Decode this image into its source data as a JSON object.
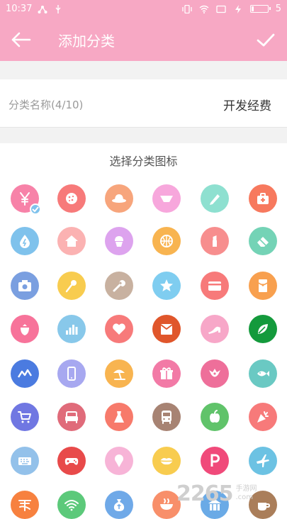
{
  "status_bar": {
    "time": "10:37",
    "battery": "5"
  },
  "toolbar": {
    "title": "添加分类"
  },
  "category_name": {
    "label": "分类名称(4/10)",
    "value": "开发经费"
  },
  "icon_section": {
    "title": "选择分类图标"
  },
  "icons": [
    {
      "name": "yen-icon",
      "color": "#f782a8",
      "selected": true
    },
    {
      "name": "cookie-icon",
      "color": "#f77a7a"
    },
    {
      "name": "hat-icon",
      "color": "#f7a57c"
    },
    {
      "name": "underwear-icon",
      "color": "#f7a7dc"
    },
    {
      "name": "pen-icon",
      "color": "#8ee0d0"
    },
    {
      "name": "first-aid-icon",
      "color": "#f7795e"
    },
    {
      "name": "water-drop-icon",
      "color": "#7fc2ec"
    },
    {
      "name": "house-icon",
      "color": "#fbb2b2"
    },
    {
      "name": "cupcake-icon",
      "color": "#dda3ee"
    },
    {
      "name": "basketball-icon",
      "color": "#f8b450"
    },
    {
      "name": "lipstick-icon",
      "color": "#f78e8e"
    },
    {
      "name": "eraser-icon",
      "color": "#74d3b6"
    },
    {
      "name": "camera-icon",
      "color": "#7a9fe0"
    },
    {
      "name": "microphone-icon",
      "color": "#f8cc4f"
    },
    {
      "name": "wrench-icon",
      "color": "#c8b1a0"
    },
    {
      "name": "star-icon",
      "color": "#7fcdf0"
    },
    {
      "name": "credit-card-icon",
      "color": "#f77a7a"
    },
    {
      "name": "red-envelope-icon",
      "color": "#f8a04f"
    },
    {
      "name": "strawberry-icon",
      "color": "#f7739a"
    },
    {
      "name": "bar-chart-icon",
      "color": "#88c8ea"
    },
    {
      "name": "heart-icon",
      "color": "#f77a7a"
    },
    {
      "name": "envelope-icon",
      "color": "#e0562b"
    },
    {
      "name": "high-heel-icon",
      "color": "#f7a7c8"
    },
    {
      "name": "leaf-icon",
      "color": "#149a3c"
    },
    {
      "name": "mountain-chart-icon",
      "color": "#4b7be0"
    },
    {
      "name": "phone-icon",
      "color": "#a7a8f0"
    },
    {
      "name": "beach-umbrella-icon",
      "color": "#f8b450"
    },
    {
      "name": "gift-icon",
      "color": "#f27aa6"
    },
    {
      "name": "bird-icon",
      "color": "#ee6f9a"
    },
    {
      "name": "fish-icon",
      "color": "#6ac9c3"
    },
    {
      "name": "shopping-cart-icon",
      "color": "#7077e2"
    },
    {
      "name": "sofa-icon",
      "color": "#e06b7a"
    },
    {
      "name": "dress-icon",
      "color": "#f77a6b"
    },
    {
      "name": "bus-icon",
      "color": "#a78373"
    },
    {
      "name": "apple-icon",
      "color": "#60c36a"
    },
    {
      "name": "party-popper-icon",
      "color": "#f77a7a"
    },
    {
      "name": "keyboard-icon",
      "color": "#93c1ea"
    },
    {
      "name": "gamepad-icon",
      "color": "#e84a4a"
    },
    {
      "name": "ice-cream-icon",
      "color": "#f7b4d7"
    },
    {
      "name": "lips-icon",
      "color": "#f8cc4f"
    },
    {
      "name": "parking-icon",
      "color": "#f04a7a"
    },
    {
      "name": "airplane-icon",
      "color": "#6cc2e3"
    },
    {
      "name": "taobao-icon",
      "color": "#f7813f"
    },
    {
      "name": "wifi-icon",
      "color": "#5cc97a"
    },
    {
      "name": "money-bag-icon",
      "color": "#6fa9e8"
    },
    {
      "name": "bowl-icon",
      "color": "#f88f6a"
    },
    {
      "name": "building-icon",
      "color": "#6aaae6"
    },
    {
      "name": "coffee-icon",
      "color": "#aa7e5a"
    }
  ],
  "watermark": {
    "number": "2265",
    "text_cn": "手游网",
    "text_en": ".com"
  }
}
